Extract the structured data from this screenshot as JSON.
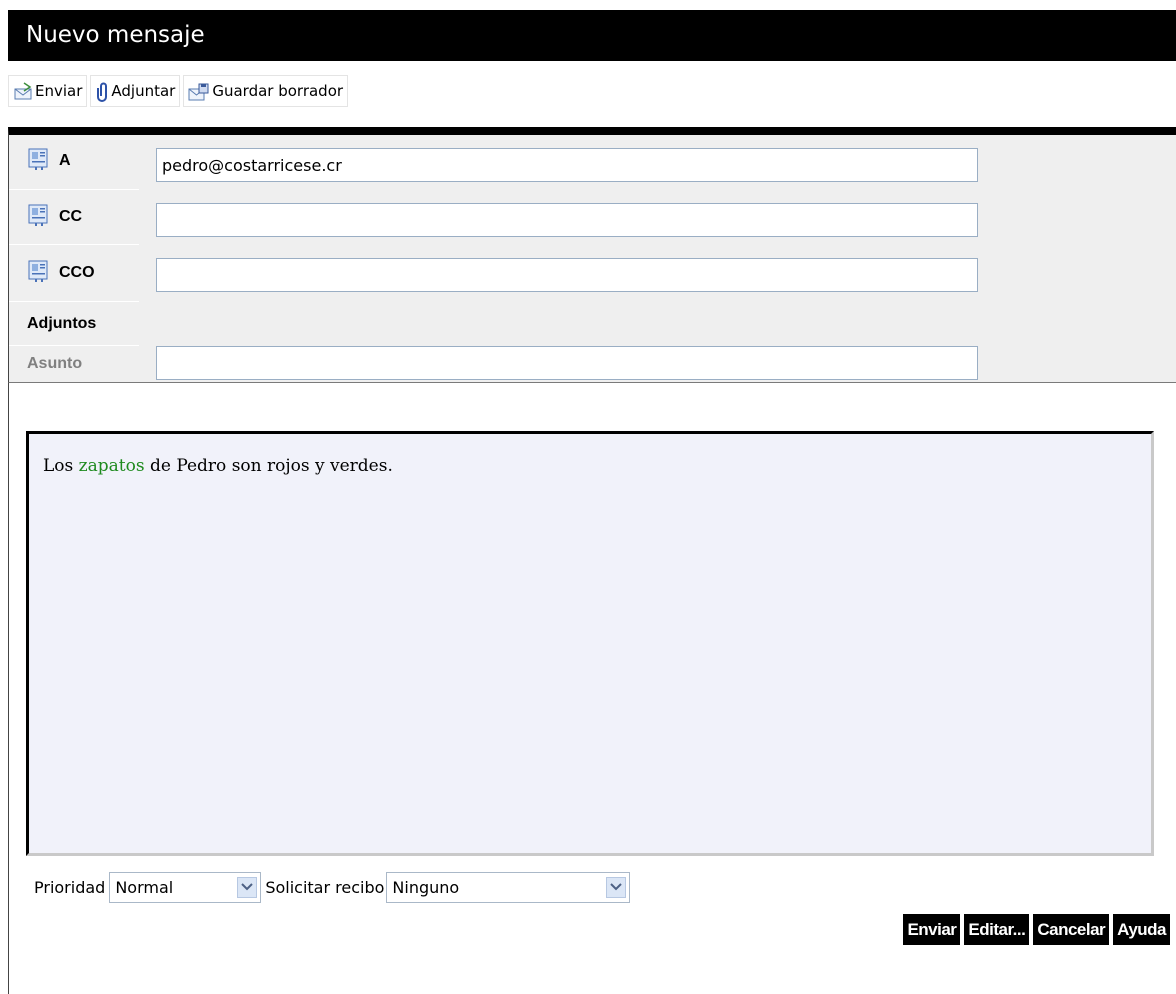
{
  "window": {
    "title": "Nuevo mensaje"
  },
  "toolbar": {
    "send_label": "Enviar",
    "attach_label": "Adjuntar",
    "save_draft_label": "Guardar borrador"
  },
  "header": {
    "to": {
      "label": "A",
      "value": "pedro@costarricese.cr"
    },
    "cc": {
      "label": "CC",
      "value": ""
    },
    "bcc": {
      "label": "CCO",
      "value": ""
    },
    "attachments_label": "Adjuntos",
    "subject": {
      "label": "Asunto",
      "value": ""
    }
  },
  "editor": {
    "text_before": "Los ",
    "highlighted_word": "zapatos",
    "text_after": " de Pedro son rojos y verdes."
  },
  "options": {
    "priority_label": "Prioridad",
    "priority_value": "Normal",
    "receipt_label": "Solicitar recibo",
    "receipt_value": "Ninguno"
  },
  "actions": {
    "send": "Enviar",
    "edit": "Editar...",
    "cancel": "Cancelar",
    "help": "Ayuda"
  },
  "colors": {
    "highlight_word": "#1e8a1e",
    "editor_bg": "#f1f2fa",
    "header_bg": "#efefef"
  }
}
